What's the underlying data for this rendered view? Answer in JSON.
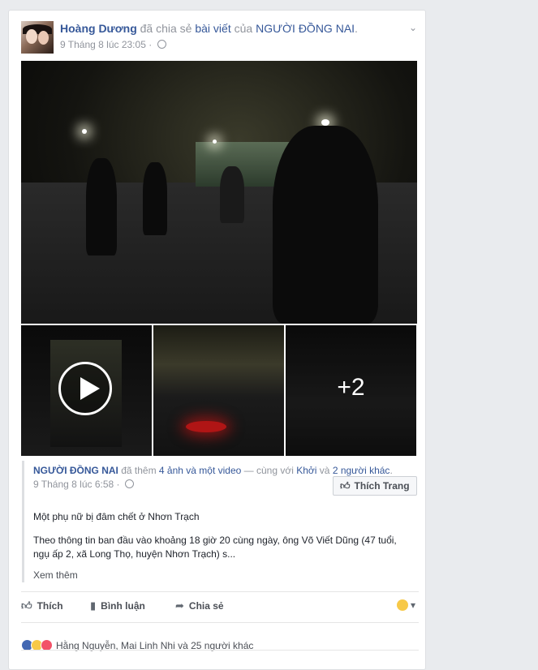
{
  "header": {
    "author": "Hoàng Dương",
    "verb_shared": "đã chia sẻ",
    "object": "bài viết",
    "of": "của",
    "page_name": "NGƯỜI ĐỒNG NAI",
    "period": ".",
    "timestamp": "9 Tháng 8 lúc 23:05",
    "separator": "·"
  },
  "media": {
    "more_count": "+2"
  },
  "shared_post": {
    "page_name": "NGƯỜI ĐỒNG NAI",
    "added_text": "đã thêm",
    "added_link": "4 ảnh và một video",
    "with_text": "— cùng với",
    "with_person": "Khởi",
    "and_text": "và",
    "others_link": "2 người khác",
    "end_period": ".",
    "timestamp": "9 Tháng 8 lúc 6:58",
    "separator": "·",
    "like_page_button": "Thích Trang",
    "title": "Một phụ nữ bị đâm chết ở Nhơn Trạch",
    "body": "Theo thông tin ban đầu vào khoảng 18 giờ 20 cùng ngày, ông Võ Viết Dũng (47 tuổi, ngụ ấp 2, xã Long Thọ, huyện Nhơn Trạch) s...",
    "see_more": "Xem thêm"
  },
  "actions": {
    "like": "Thích",
    "comment": "Bình luận",
    "share": "Chia sẻ"
  },
  "reactions": {
    "summary": "Hằng Nguyễn, Mai Linh Nhi và 25 người khác"
  }
}
